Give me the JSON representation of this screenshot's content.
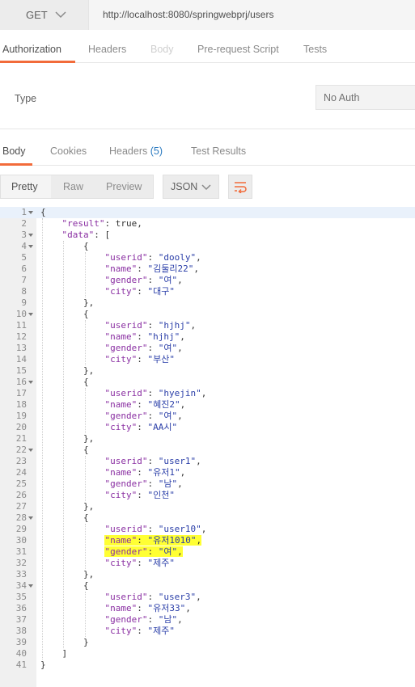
{
  "request": {
    "method": "GET",
    "url": "http://localhost:8080/springwebprj/users"
  },
  "request_tabs": [
    "Authorization",
    "Headers",
    "Body",
    "Pre-request Script",
    "Tests"
  ],
  "auth": {
    "type_label": "Type",
    "type_value": "No Auth"
  },
  "response_tabs": {
    "body": "Body",
    "cookies": "Cookies",
    "headers": "Headers",
    "headers_count": "(5)",
    "test_results": "Test Results"
  },
  "toolbar": {
    "view_modes": [
      "Pretty",
      "Raw",
      "Preview"
    ],
    "format": "JSON"
  },
  "colors": {
    "accent": "#f26b3a",
    "key": "#8a2fa2",
    "string": "#2a3ea8",
    "highlight": "#ffff33"
  },
  "code_lines": [
    "{",
    "    \"result\": true,",
    "    \"data\": [",
    "        {",
    "            \"userid\": \"dooly\",",
    "            \"name\": \"김둘리22\",",
    "            \"gender\": \"여\",",
    "            \"city\": \"대구\"",
    "        },",
    "        {",
    "            \"userid\": \"hjhj\",",
    "            \"name\": \"hjhj\",",
    "            \"gender\": \"여\",",
    "            \"city\": \"부산\"",
    "        },",
    "        {",
    "            \"userid\": \"hyejin\",",
    "            \"name\": \"혜진2\",",
    "            \"gender\": \"여\",",
    "            \"city\": \"AA시\"",
    "        },",
    "        {",
    "            \"userid\": \"user1\",",
    "            \"name\": \"유저1\",",
    "            \"gender\": \"남\",",
    "            \"city\": \"인천\"",
    "        },",
    "        {",
    "            \"userid\": \"user10\",",
    "            \"name\": \"유저1010\",",
    "            \"gender\": \"여\",",
    "            \"city\": \"제주\"",
    "        },",
    "        {",
    "            \"userid\": \"user3\",",
    "            \"name\": \"유저33\",",
    "            \"gender\": \"남\",",
    "            \"city\": \"제주\"",
    "        }",
    "    ]",
    "}"
  ],
  "fold_lines": [
    1,
    3,
    4,
    10,
    16,
    22,
    28,
    34
  ],
  "highlighted_lines": [
    30,
    31
  ]
}
